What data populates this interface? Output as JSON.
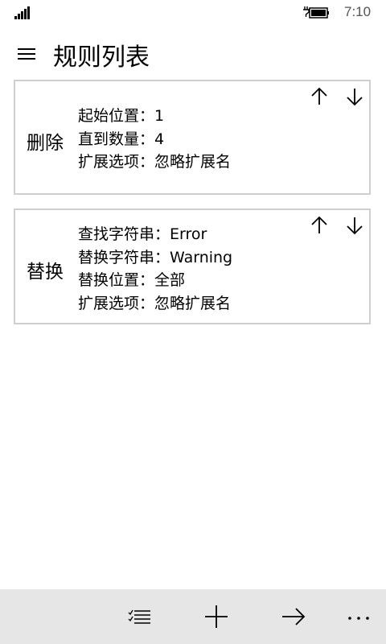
{
  "status": {
    "time": "7:10"
  },
  "header": {
    "title": "规则列表"
  },
  "rules": [
    {
      "type": "删除",
      "details": [
        "起始位置：1",
        "直到数量：4",
        "扩展选项：忽略扩展名"
      ]
    },
    {
      "type": "替换",
      "details": [
        "查找字符串：Error",
        "替换字符串：Warning",
        "替换位置：全部",
        "扩展选项：忽略扩展名"
      ]
    }
  ],
  "app_bar": {
    "icons": [
      "select-list-icon",
      "add-icon",
      "arrow-right-icon",
      "more-icon"
    ]
  }
}
